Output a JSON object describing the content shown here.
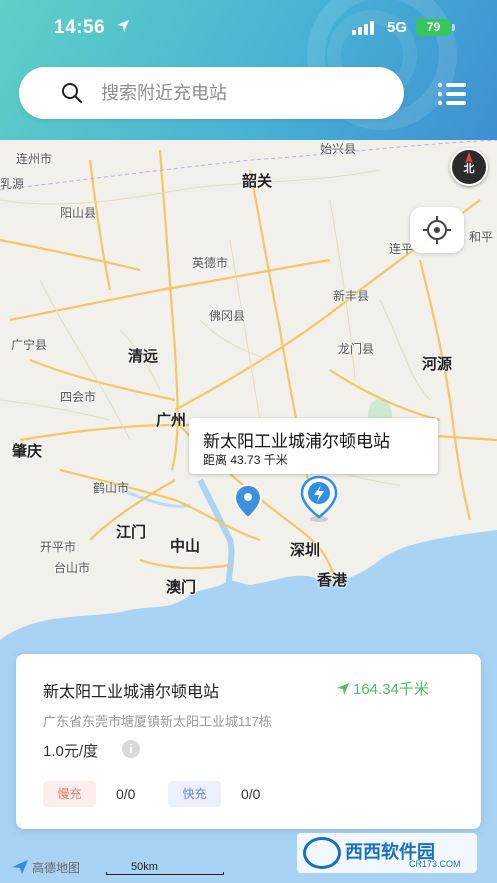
{
  "status_bar": {
    "time": "14:56",
    "network": "5G",
    "battery": "79"
  },
  "search": {
    "placeholder": "搜索附近充电站"
  },
  "map": {
    "compass_label": "北",
    "labels": [
      {
        "text": "连州市",
        "kind": "small"
      },
      {
        "text": "乳源",
        "kind": "small"
      },
      {
        "text": "韶关",
        "kind": "big"
      },
      {
        "text": "始兴县",
        "kind": "small"
      },
      {
        "text": "阳山县",
        "kind": "small"
      },
      {
        "text": "英德市",
        "kind": "small"
      },
      {
        "text": "连平",
        "kind": "small"
      },
      {
        "text": "和平",
        "kind": "small"
      },
      {
        "text": "新丰县",
        "kind": "small"
      },
      {
        "text": "佛冈县",
        "kind": "small"
      },
      {
        "text": "广宁县",
        "kind": "small"
      },
      {
        "text": "清远",
        "kind": "big"
      },
      {
        "text": "龙门县",
        "kind": "small"
      },
      {
        "text": "河源",
        "kind": "big"
      },
      {
        "text": "四会市",
        "kind": "small"
      },
      {
        "text": "广州",
        "kind": "big"
      },
      {
        "text": "肇庆",
        "kind": "big"
      },
      {
        "text": "鹤山市",
        "kind": "small"
      },
      {
        "text": "江门",
        "kind": "big"
      },
      {
        "text": "中山",
        "kind": "big"
      },
      {
        "text": "开平市",
        "kind": "small"
      },
      {
        "text": "台山市",
        "kind": "small"
      },
      {
        "text": "深圳",
        "kind": "big"
      },
      {
        "text": "澳门",
        "kind": "big"
      },
      {
        "text": "香港",
        "kind": "big"
      }
    ],
    "callout": {
      "name": "新太阳工业城浦尔顿电站",
      "distance": "距离 43.73 千米"
    },
    "scale_label": "50km",
    "brand": "高德地图"
  },
  "station_card": {
    "name": "新太阳工业城浦尔顿电站",
    "distance": "164.34千米",
    "address": "广东省东莞市塘厦镇新太阳工业城117栋",
    "price": "1.0元/度",
    "slow_label": "慢充",
    "slow_count": "0/0",
    "fast_label": "快充",
    "fast_count": "0/0"
  },
  "watermark": {
    "main": "西西软件园",
    "sub": "CR173.COM"
  },
  "colors": {
    "accent_green": "#4cbf62",
    "header_start": "#5fd0c6",
    "header_end": "#3e8fd2"
  }
}
